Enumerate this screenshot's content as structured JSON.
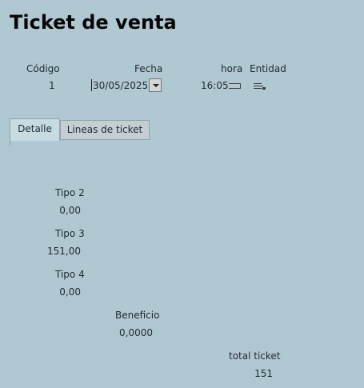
{
  "header": {
    "title": "Ticket de venta"
  },
  "fields": {
    "codigo": {
      "label": "Código",
      "value": "1"
    },
    "fecha": {
      "label": "Fecha",
      "value": "30/05/2025"
    },
    "hora": {
      "label": "hora",
      "value": "16:05"
    },
    "entidad": {
      "label": "Entidad"
    }
  },
  "tabs": [
    {
      "label": "Detalle",
      "active": true
    },
    {
      "label": "Lineas de ticket",
      "active": false
    }
  ],
  "detalle": {
    "tipo2": {
      "label": "Tipo 2",
      "value": "0,00"
    },
    "tipo3": {
      "label": "Tipo 3",
      "value": "151,00"
    },
    "tipo4": {
      "label": "Tipo 4",
      "value": "0,00"
    },
    "beneficio": {
      "label": "Beneficio",
      "value": "0,0000"
    },
    "total": {
      "label": "total ticket",
      "value": "151"
    }
  },
  "icons": {
    "fecha_dropdown": "chevron-down-icon",
    "hora_spinner": "time-picker-icon",
    "entidad_lookup": "lookup-icon"
  }
}
